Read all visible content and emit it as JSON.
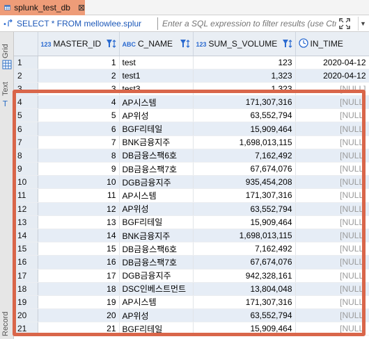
{
  "tab": {
    "title": "splunk_test_db",
    "close": "⊠"
  },
  "filter": {
    "query": "SELECT * FROM mellowlee.splur",
    "placeholder": "Enter a SQL expression to filter results (use Ctrl+"
  },
  "side_panel": {
    "grid_label": "Grid",
    "text_label": "Text",
    "record_label": "Record"
  },
  "columns": [
    {
      "type": "123",
      "name": "MASTER_ID"
    },
    {
      "type": "ABC",
      "name": "C_NAME"
    },
    {
      "type": "123",
      "name": "SUM_S_VOLUME"
    },
    {
      "type": "clock",
      "name": "IN_TIME"
    }
  ],
  "rows": [
    {
      "n": "1",
      "id": "1",
      "name": "test",
      "vol": "123",
      "time": "2020-04-12"
    },
    {
      "n": "2",
      "id": "2",
      "name": "test1",
      "vol": "1,323",
      "time": "2020-04-12"
    },
    {
      "n": "3",
      "id": "3",
      "name": "test3",
      "vol": "1,323",
      "time": "[NULL]"
    },
    {
      "n": "4",
      "id": "4",
      "name": "AP시스템",
      "vol": "171,307,316",
      "time": "[NULL]"
    },
    {
      "n": "5",
      "id": "5",
      "name": "AP위성",
      "vol": "63,552,794",
      "time": "[NULL]"
    },
    {
      "n": "6",
      "id": "6",
      "name": "BGF리테일",
      "vol": "15,909,464",
      "time": "[NULL]"
    },
    {
      "n": "7",
      "id": "7",
      "name": "BNK금융지주",
      "vol": "1,698,013,115",
      "time": "[NULL]"
    },
    {
      "n": "8",
      "id": "8",
      "name": "DB금융스팩6호",
      "vol": "7,162,492",
      "time": "[NULL]"
    },
    {
      "n": "9",
      "id": "9",
      "name": "DB금융스팩7호",
      "vol": "67,674,076",
      "time": "[NULL]"
    },
    {
      "n": "10",
      "id": "10",
      "name": "DGB금융지주",
      "vol": "935,454,208",
      "time": "[NULL]"
    },
    {
      "n": "11",
      "id": "11",
      "name": "AP시스템",
      "vol": "171,307,316",
      "time": "[NULL]"
    },
    {
      "n": "12",
      "id": "12",
      "name": "AP위성",
      "vol": "63,552,794",
      "time": "[NULL]"
    },
    {
      "n": "13",
      "id": "13",
      "name": "BGF리테일",
      "vol": "15,909,464",
      "time": "[NULL]"
    },
    {
      "n": "14",
      "id": "14",
      "name": "BNK금융지주",
      "vol": "1,698,013,115",
      "time": "[NULL]"
    },
    {
      "n": "15",
      "id": "15",
      "name": "DB금융스팩6호",
      "vol": "7,162,492",
      "time": "[NULL]"
    },
    {
      "n": "16",
      "id": "16",
      "name": "DB금융스팩7호",
      "vol": "67,674,076",
      "time": "[NULL]"
    },
    {
      "n": "17",
      "id": "17",
      "name": "DGB금융지주",
      "vol": "942,328,161",
      "time": "[NULL]"
    },
    {
      "n": "18",
      "id": "18",
      "name": "DSC인베스트먼트",
      "vol": "13,804,048",
      "time": "[NULL]"
    },
    {
      "n": "19",
      "id": "19",
      "name": "AP시스템",
      "vol": "171,307,316",
      "time": "[NULL]"
    },
    {
      "n": "20",
      "id": "20",
      "name": "AP위성",
      "vol": "63,552,794",
      "time": "[NULL]"
    },
    {
      "n": "21",
      "id": "21",
      "name": "BGF리테일",
      "vol": "15,909,464",
      "time": "[NULL]"
    }
  ],
  "colors": {
    "tab_active": "#ee9c78",
    "highlight": "#d9664a",
    "alt_row": "#e6edf6",
    "link_blue": "#1b57b8"
  }
}
